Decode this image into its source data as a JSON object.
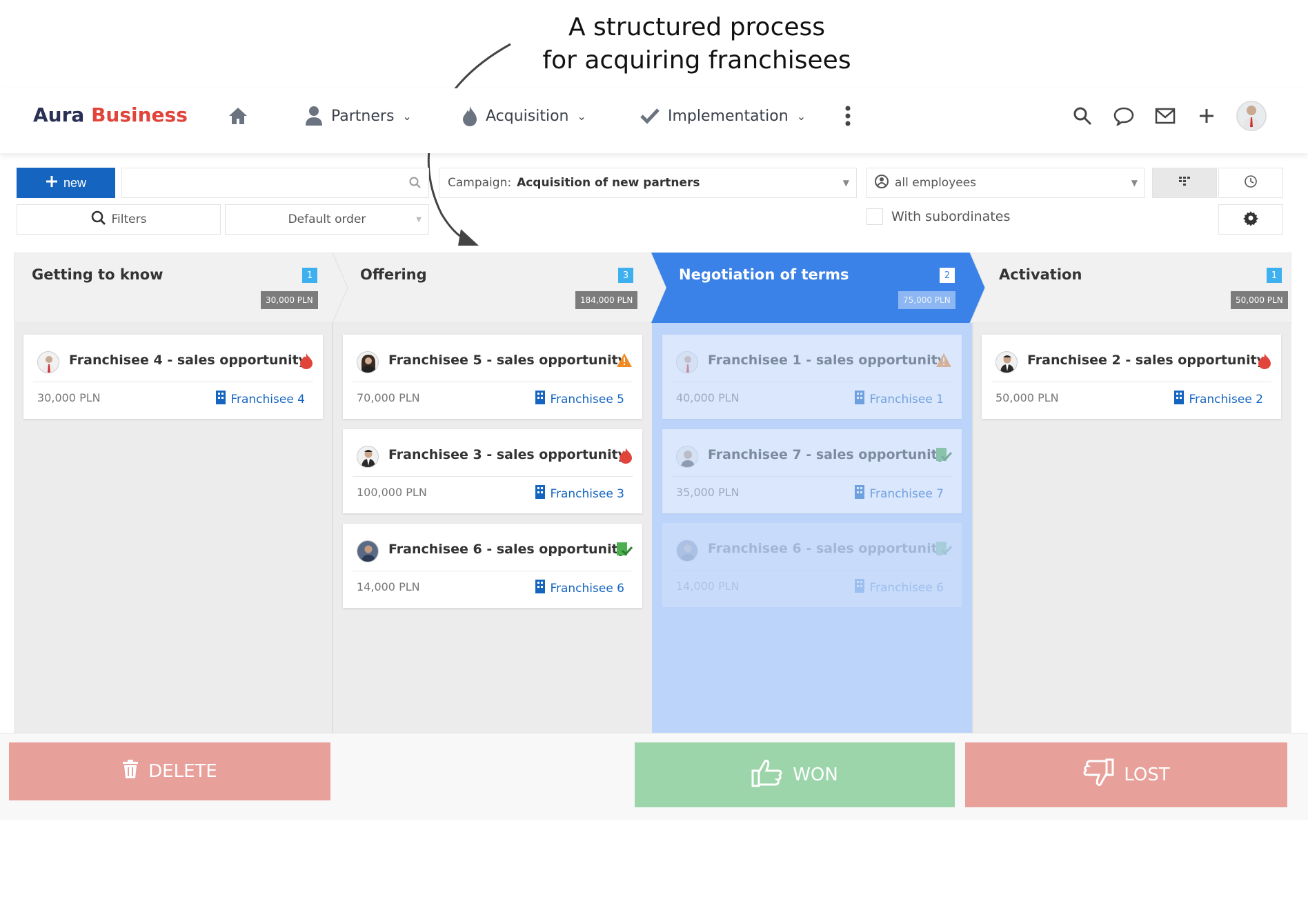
{
  "annotation": {
    "line1": "A structured process",
    "line2": "for acquiring franchisees"
  },
  "nav": {
    "brand_part1": "Aura",
    "brand_part2": "Business",
    "home_icon": "home-icon",
    "items": [
      {
        "label": "Partners",
        "icon": "user-icon"
      },
      {
        "label": "Acquisition",
        "icon": "flame-icon"
      },
      {
        "label": "Implementation",
        "icon": "check-icon"
      }
    ],
    "right_icons": [
      "search-icon",
      "chat-icon",
      "mail-icon",
      "plus-icon",
      "avatar"
    ]
  },
  "toolbar": {
    "new_label": "new",
    "search_placeholder": "",
    "campaign_label": "Campaign:",
    "campaign_value": "Acquisition of new partners",
    "employees_value": "all employees",
    "filters_label": "Filters",
    "order_label": "Default order",
    "subordinates_label": "With subordinates"
  },
  "stages": [
    {
      "title": "Getting to know",
      "count": "1",
      "amount": "30,000 PLN"
    },
    {
      "title": "Offering",
      "count": "3",
      "amount": "184,000 PLN"
    },
    {
      "title": "Negotiation of terms",
      "count": "2",
      "amount": "75,000 PLN"
    },
    {
      "title": "Activation",
      "count": "1",
      "amount": "50,000 PLN"
    }
  ],
  "cards": {
    "c1": {
      "title": "Franchisee 4 - sales opportunity",
      "amount": "30,000 PLN",
      "company": "Franchisee 4",
      "flag": "fire-icon"
    },
    "c2": {
      "title": "Franchisee 5 - sales opportunity",
      "amount": "70,000 PLN",
      "company": "Franchisee 5",
      "flag": "warning-icon"
    },
    "c3": {
      "title": "Franchisee 3 - sales opportunity",
      "amount": "100,000 PLN",
      "company": "Franchisee 3",
      "flag": "fire-icon"
    },
    "c4": {
      "title": "Franchisee 6 - sales opportunity",
      "amount": "14,000 PLN",
      "company": "Franchisee 6",
      "flag": "approved-icon"
    },
    "c5": {
      "title": "Franchisee 1 - sales opportunity",
      "amount": "40,000 PLN",
      "company": "Franchisee 1",
      "flag": "warning-icon"
    },
    "c6": {
      "title": "Franchisee 7 - sales opportunity",
      "amount": "35,000 PLN",
      "company": "Franchisee 7",
      "flag": "approved-icon"
    },
    "c7": {
      "title": "Franchisee 6 - sales opportunity",
      "amount": "14,000 PLN",
      "company": "Franchisee 6",
      "flag": "approved-icon"
    },
    "c8": {
      "title": "Franchisee 2 - sales opportunity",
      "amount": "50,000 PLN",
      "company": "Franchisee 2",
      "flag": "fire-icon"
    }
  },
  "actions": {
    "delete_label": "DELETE",
    "won_label": "WON",
    "lost_label": "LOST"
  },
  "colors": {
    "brand_dark": "#2a2f55",
    "brand_red": "#e0443a",
    "primary": "#1565c0",
    "active_stage": "#3b82e8",
    "won": "#9bd5a9",
    "lost": "#e8a09a"
  }
}
